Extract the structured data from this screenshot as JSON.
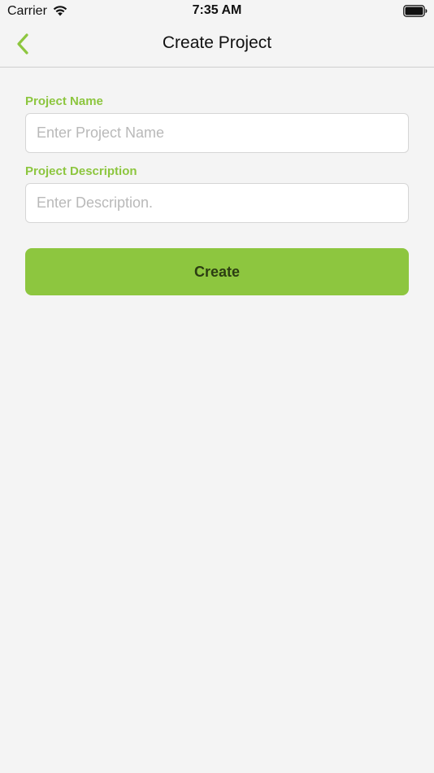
{
  "status_bar": {
    "carrier": "Carrier",
    "time": "7:35 AM"
  },
  "nav": {
    "title": "Create Project"
  },
  "form": {
    "project_name": {
      "label": "Project Name",
      "placeholder": "Enter Project Name",
      "value": ""
    },
    "project_description": {
      "label": "Project Description",
      "placeholder": "Enter Description.",
      "value": ""
    },
    "create_label": "Create"
  },
  "colors": {
    "accent": "#8dc63f",
    "button_text": "#2c3d12",
    "background": "#f4f4f4"
  },
  "icons": {
    "back": "chevron-left-icon",
    "wifi": "wifi-icon",
    "battery": "battery-icon"
  }
}
